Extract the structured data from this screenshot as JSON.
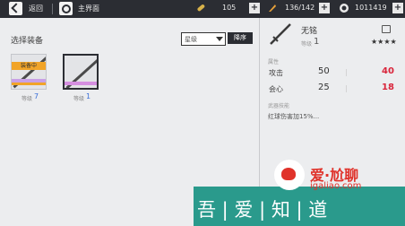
{
  "topbar": {
    "back_label": "返回",
    "home_label": "主界面",
    "resources": [
      {
        "icon": "pill-icon",
        "value": "105"
      },
      {
        "icon": "stamina-icon",
        "value": "136/142"
      },
      {
        "icon": "coin-icon",
        "value": "1011419"
      }
    ],
    "plus": "+"
  },
  "left": {
    "title": "选择装备",
    "filter_value": "星级",
    "sort_label": "降序",
    "items": [
      {
        "tag": "装备中",
        "level_label": "等级",
        "level": "7",
        "strip_color": "#c8a0e6"
      },
      {
        "tag": "",
        "level_label": "等级",
        "level": "1",
        "strip_color": "#d58fe0"
      }
    ]
  },
  "detail": {
    "name": "无铭",
    "level_label": "等级",
    "level": "1",
    "stars": "★★★★",
    "attr_title": "属性",
    "stats": [
      {
        "name": "攻击",
        "value": "50",
        "next": "40"
      },
      {
        "name": "会心",
        "value": "25",
        "next": "18"
      }
    ],
    "skill_title": "武器技能",
    "skill_text": "红球伤害加15%..."
  },
  "watermark": {
    "top_text": "爱·尬聊",
    "url": "igaliao.com",
    "bottom_text": "吾 | 爱 | 知 | 道"
  },
  "colors": {
    "topbar_bg": "#2b2d33",
    "accent_red": "#d9253b",
    "level_blue": "#3a6fd8",
    "equip_tag": "#f1a428",
    "watermark_green": "#2a9a8c"
  }
}
